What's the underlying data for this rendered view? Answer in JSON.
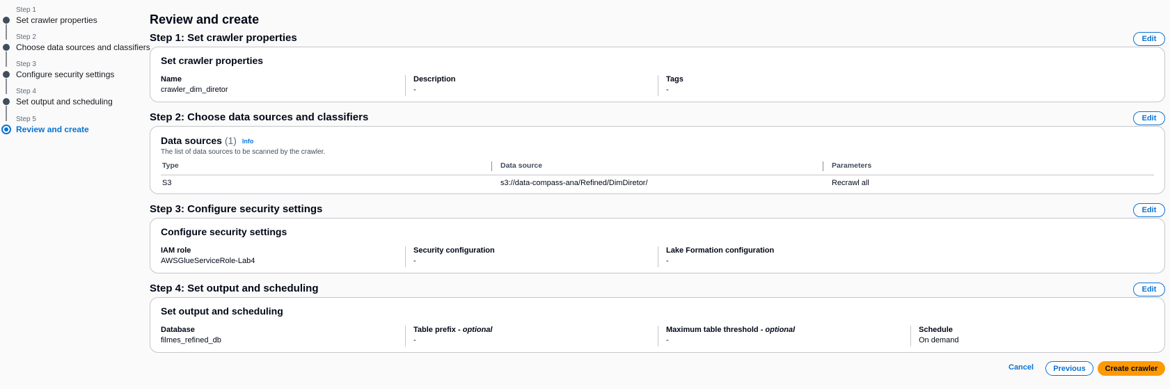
{
  "nav": {
    "steps": [
      {
        "num": "Step 1",
        "label": "Set crawler properties"
      },
      {
        "num": "Step 2",
        "label": "Choose data sources and classifiers"
      },
      {
        "num": "Step 3",
        "label": "Configure security settings"
      },
      {
        "num": "Step 4",
        "label": "Set output and scheduling"
      },
      {
        "num": "Step 5",
        "label": "Review and create"
      }
    ]
  },
  "page": {
    "title": "Review and create"
  },
  "edit_label": "Edit",
  "step1": {
    "heading": "Step 1: Set crawler properties",
    "card_title": "Set crawler properties",
    "fields": [
      {
        "label": "Name",
        "value": "crawler_dim_diretor"
      },
      {
        "label": "Description",
        "value": "-"
      },
      {
        "label": "Tags",
        "value": "-"
      }
    ]
  },
  "step2": {
    "heading": "Step 2: Choose data sources and classifiers",
    "title": "Data sources",
    "count": "(1)",
    "info": "Info",
    "description": "The list of data sources to be scanned by the crawler.",
    "columns": [
      "Type",
      "Data source",
      "Parameters"
    ],
    "rows": [
      [
        "S3",
        "s3://data-compass-ana/Refined/DimDiretor/",
        "Recrawl all"
      ]
    ]
  },
  "step3": {
    "heading": "Step 3: Configure security settings",
    "card_title": "Configure security settings",
    "fields": [
      {
        "label": "IAM role",
        "value": "AWSGlueServiceRole-Lab4"
      },
      {
        "label": "Security configuration",
        "value": "-"
      },
      {
        "label": "Lake Formation configuration",
        "value": "-"
      }
    ]
  },
  "step4": {
    "heading": "Step 4: Set output and scheduling",
    "card_title": "Set output and scheduling",
    "fields": [
      {
        "label": "Database",
        "optional": "",
        "value": "filmes_refined_db"
      },
      {
        "label": "Table prefix",
        "optional": "optional",
        "value": "-"
      },
      {
        "label": "Maximum table threshold",
        "optional": "optional",
        "value": "-"
      },
      {
        "label": "Schedule",
        "optional": "",
        "value": "On demand"
      }
    ]
  },
  "footer": {
    "cancel": "Cancel",
    "previous": "Previous",
    "create": "Create crawler"
  },
  "colors": {
    "accent": "#0972d3",
    "primary_button": "#ff9900"
  }
}
